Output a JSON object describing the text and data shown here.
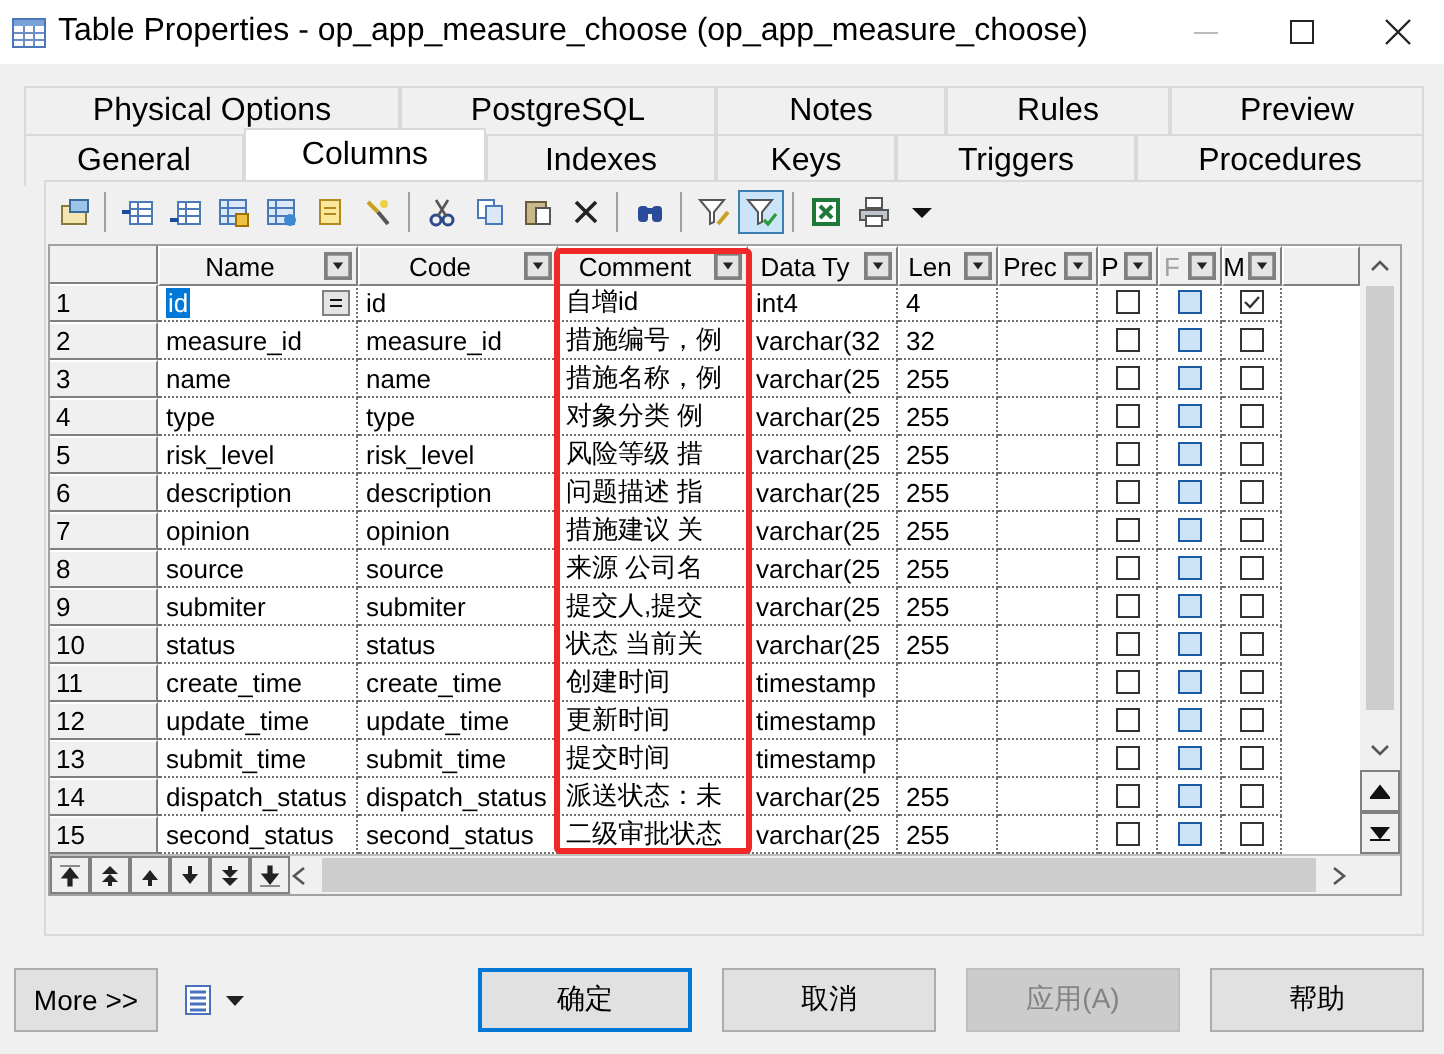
{
  "window": {
    "title": "Table Properties - op_app_measure_choose (op_app_measure_choose)"
  },
  "tabs": [
    [
      {
        "label": "Physical Options",
        "selected": false
      },
      {
        "label": "PostgreSQL",
        "selected": false
      },
      {
        "label": "Notes",
        "selected": false
      },
      {
        "label": "Rules",
        "selected": false
      },
      {
        "label": "Preview",
        "selected": false
      }
    ],
    [
      {
        "label": "General",
        "selected": false
      },
      {
        "label": "Columns",
        "selected": true
      },
      {
        "label": "Indexes",
        "selected": false
      },
      {
        "label": "Keys",
        "selected": false
      },
      {
        "label": "Triggers",
        "selected": false
      },
      {
        "label": "Procedures",
        "selected": false
      }
    ]
  ],
  "toolbar": [
    {
      "kind": "properties",
      "pressed": false
    },
    {
      "kind": "separator"
    },
    {
      "kind": "insert-row",
      "pressed": false
    },
    {
      "kind": "add-row",
      "pressed": false
    },
    {
      "kind": "add-columns",
      "pressed": false
    },
    {
      "kind": "replace-columns",
      "pressed": false
    },
    {
      "kind": "domain",
      "pressed": false
    },
    {
      "kind": "wizard",
      "pressed": false
    },
    {
      "kind": "separator"
    },
    {
      "kind": "cut",
      "pressed": false
    },
    {
      "kind": "copy",
      "pressed": false
    },
    {
      "kind": "paste",
      "pressed": false
    },
    {
      "kind": "delete",
      "pressed": false
    },
    {
      "kind": "separator"
    },
    {
      "kind": "find",
      "pressed": false
    },
    {
      "kind": "separator"
    },
    {
      "kind": "filter",
      "pressed": false
    },
    {
      "kind": "filter-toggle",
      "pressed": true
    },
    {
      "kind": "separator"
    },
    {
      "kind": "excel",
      "pressed": false
    },
    {
      "kind": "print",
      "pressed": false
    },
    {
      "kind": "dropdown",
      "pressed": false
    }
  ],
  "grid": {
    "columns": [
      {
        "label": "Name",
        "highlighted": false,
        "disabled": false
      },
      {
        "label": "Code",
        "highlighted": false,
        "disabled": false
      },
      {
        "label": "Comment",
        "highlighted": true,
        "disabled": false
      },
      {
        "label": "Data Ty",
        "highlighted": false,
        "disabled": false
      },
      {
        "label": "Len",
        "highlighted": false,
        "disabled": false
      },
      {
        "label": "Prec",
        "highlighted": false,
        "disabled": false
      },
      {
        "label": "P",
        "highlighted": false,
        "disabled": false
      },
      {
        "label": "F",
        "highlighted": false,
        "disabled": true
      },
      {
        "label": "M",
        "highlighted": false,
        "disabled": false
      }
    ],
    "rows": [
      {
        "number": "1",
        "name": "id",
        "code": "id",
        "comment": "自增id",
        "data_type": "int4",
        "length": "4",
        "primary": false,
        "foreign": false,
        "mandatory": true,
        "selected": true
      },
      {
        "number": "2",
        "name": "measure_id",
        "code": "measure_id",
        "comment": "措施编号，例",
        "data_type": "varchar(32",
        "length": "32",
        "primary": false,
        "foreign": false,
        "mandatory": false,
        "selected": false
      },
      {
        "number": "3",
        "name": "name",
        "code": "name",
        "comment": "措施名称，例",
        "data_type": "varchar(25",
        "length": "255",
        "primary": false,
        "foreign": false,
        "mandatory": false,
        "selected": false
      },
      {
        "number": "4",
        "name": "type",
        "code": "type",
        "comment": "对象分类 例",
        "data_type": "varchar(25",
        "length": "255",
        "primary": false,
        "foreign": false,
        "mandatory": false,
        "selected": false
      },
      {
        "number": "5",
        "name": "risk_level",
        "code": "risk_level",
        "comment": "风险等级 措",
        "data_type": "varchar(25",
        "length": "255",
        "primary": false,
        "foreign": false,
        "mandatory": false,
        "selected": false
      },
      {
        "number": "6",
        "name": "description",
        "code": "description",
        "comment": "问题描述 指",
        "data_type": "varchar(25",
        "length": "255",
        "primary": false,
        "foreign": false,
        "mandatory": false,
        "selected": false
      },
      {
        "number": "7",
        "name": "opinion",
        "code": "opinion",
        "comment": "措施建议 关",
        "data_type": "varchar(25",
        "length": "255",
        "primary": false,
        "foreign": false,
        "mandatory": false,
        "selected": false
      },
      {
        "number": "8",
        "name": "source",
        "code": "source",
        "comment": "来源 公司名",
        "data_type": "varchar(25",
        "length": "255",
        "primary": false,
        "foreign": false,
        "mandatory": false,
        "selected": false
      },
      {
        "number": "9",
        "name": "submiter",
        "code": "submiter",
        "comment": "提交人,提交",
        "data_type": "varchar(25",
        "length": "255",
        "primary": false,
        "foreign": false,
        "mandatory": false,
        "selected": false
      },
      {
        "number": "10",
        "name": "status",
        "code": "status",
        "comment": "状态 当前关",
        "data_type": "varchar(25",
        "length": "255",
        "primary": false,
        "foreign": false,
        "mandatory": false,
        "selected": false
      },
      {
        "number": "11",
        "name": "create_time",
        "code": "create_time",
        "comment": "创建时间",
        "data_type": "timestamp",
        "primary": false,
        "foreign": false,
        "mandatory": false,
        "selected": false
      },
      {
        "number": "12",
        "name": "update_time",
        "code": "update_time",
        "comment": "更新时间",
        "data_type": "timestamp",
        "primary": false,
        "foreign": false,
        "mandatory": false,
        "selected": false
      },
      {
        "number": "13",
        "name": "submit_time",
        "code": "submit_time",
        "comment": "提交时间",
        "data_type": "timestamp",
        "primary": false,
        "foreign": false,
        "mandatory": false,
        "selected": false
      },
      {
        "number": "14",
        "name": "dispatch_status",
        "code": "dispatch_status",
        "comment": "派送状态：未",
        "data_type": "varchar(25",
        "length": "255",
        "primary": false,
        "foreign": false,
        "mandatory": false,
        "selected": false
      },
      {
        "number": "15",
        "name": "second_status",
        "code": "second_status",
        "comment": "二级审批状态",
        "data_type": "varchar(25",
        "length": "255",
        "primary": false,
        "foreign": false,
        "mandatory": false,
        "selected": false
      }
    ]
  },
  "footer": {
    "more_button": "More >>",
    "buttons": [
      {
        "label": "确定",
        "default": true,
        "disabled": false
      },
      {
        "label": "取消",
        "default": false,
        "disabled": false
      },
      {
        "label": "应用(A)",
        "default": false,
        "disabled": true
      },
      {
        "label": "帮助",
        "default": false,
        "disabled": false
      }
    ]
  }
}
